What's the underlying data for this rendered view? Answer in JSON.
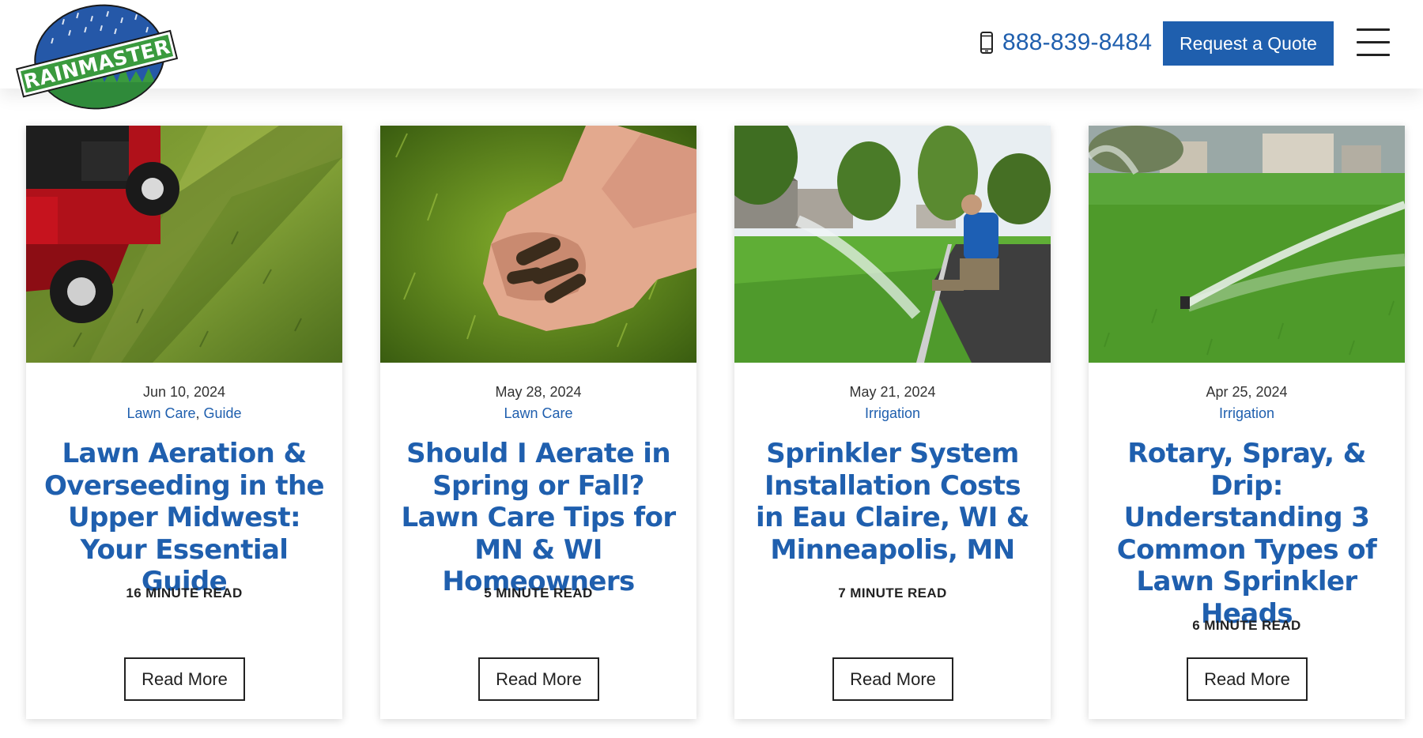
{
  "header": {
    "logo_text": "RAINMASTER",
    "phone": "888-839-8484",
    "quote_label": "Request a Quote"
  },
  "colors": {
    "brand_blue": "#1f5fae",
    "logo_green": "#2f8a3a",
    "text_dark": "#222222"
  },
  "posts": [
    {
      "date": "Jun 10, 2024",
      "categories": [
        "Lawn Care",
        "Guide"
      ],
      "title": "Lawn Aeration & Overseeding in the Upper Midwest: Your Essential Guide",
      "read_time": "16 MINUTE READ",
      "button": "Read More",
      "image": "lawn-aerator-machine-photo"
    },
    {
      "date": "May 28, 2024",
      "categories": [
        "Lawn Care"
      ],
      "title": "Should I Aerate in Spring or Fall? Lawn Care Tips for MN & WI Homeowners",
      "read_time": "5 MINUTE READ",
      "button": "Read More",
      "image": "hands-holding-soil-plugs-photo"
    },
    {
      "date": "May 21, 2024",
      "categories": [
        "Irrigation"
      ],
      "title": "Sprinkler System Installation Costs in Eau Claire, WI & Minneapolis, MN",
      "read_time": "7 MINUTE READ",
      "button": "Read More",
      "image": "technician-adjusting-sprinkler-photo"
    },
    {
      "date": "Apr 25, 2024",
      "categories": [
        "Irrigation"
      ],
      "title": "Rotary, Spray, & Drip: Understanding 3 Common Types of Lawn Sprinkler Heads",
      "read_time": "6 MINUTE READ",
      "button": "Read More",
      "image": "sprinkler-spraying-lawn-photo"
    }
  ]
}
